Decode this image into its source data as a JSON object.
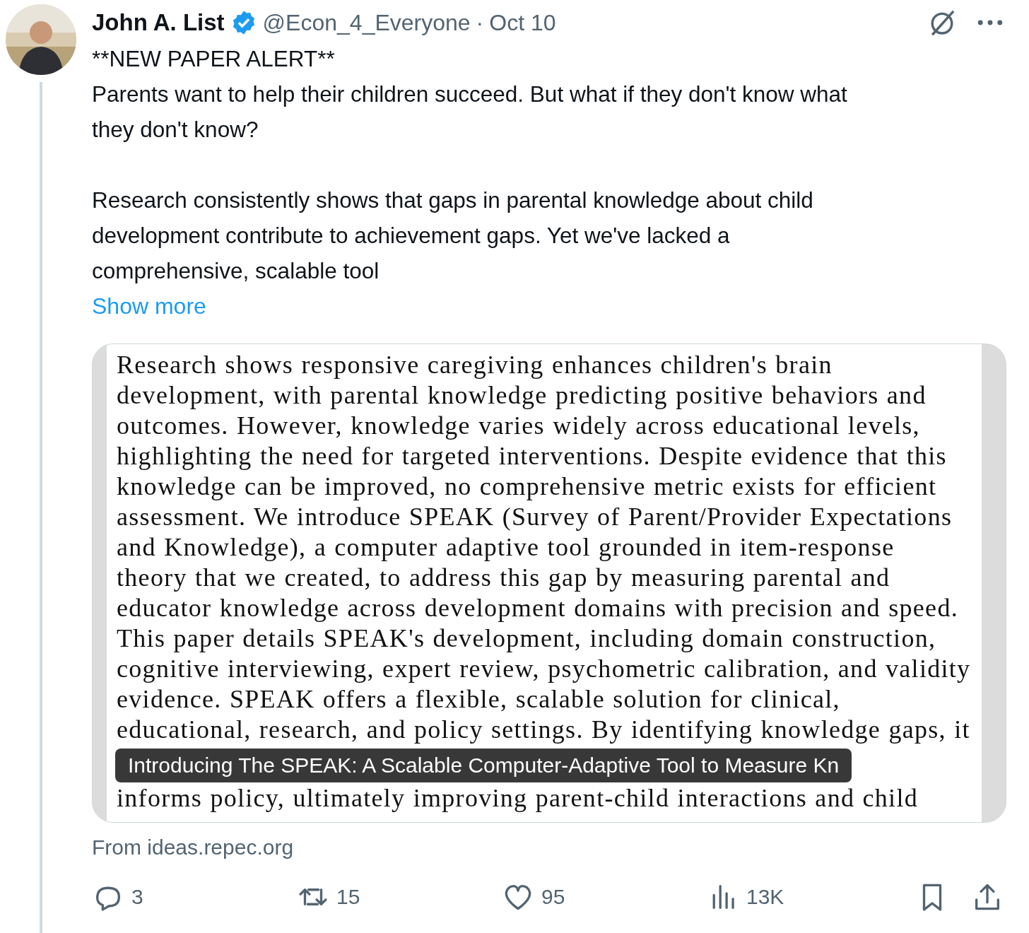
{
  "author": {
    "name": "John A. List",
    "verified": true,
    "handle": "@Econ_4_Everyone",
    "separator": "·",
    "date": "Oct 10"
  },
  "body": [
    "**NEW PAPER ALERT**\nParents want to help their children succeed. But what if they don't know what\nthey don't know?",
    "Research consistently shows that gaps in parental knowledge about child\ndevelopment contribute to achievement gaps. Yet we've lacked a\ncomprehensive, scalable tool"
  ],
  "show_more": "Show more",
  "card": {
    "document_lines": [
      "Research shows responsive caregiving enhances children's brain",
      "development, with parental knowledge predicting positive behaviors and",
      "outcomes. However, knowledge varies widely across educational levels,",
      "highlighting the need for targeted interventions. Despite evidence that this",
      "knowledge can be improved, no comprehensive metric exists for efficient",
      "assessment. We introduce SPEAK (Survey of Parent/Provider Expectations",
      "and Knowledge), a computer adaptive tool grounded in item-response",
      "theory that we created, to address this gap by measuring parental and",
      "educator knowledge across development domains with precision and speed.",
      "This paper details SPEAK's development, including domain construction,",
      "cognitive interviewing, expert review, psychometric calibration, and validity",
      "evidence. SPEAK offers a flexible, scalable solution for clinical,",
      "educational, research, and policy settings. By identifying knowledge gaps, it",
      "informs policy, ultimately improving parent-child interactions and child"
    ],
    "caption": "Introducing The SPEAK: A Scalable Computer-Adaptive Tool to Measure Kn"
  },
  "source": "From ideas.repec.org",
  "actions": [
    {
      "kind": "reply",
      "count": "3"
    },
    {
      "kind": "repost",
      "count": "15"
    },
    {
      "kind": "like",
      "count": "95"
    },
    {
      "kind": "views",
      "count": "13K"
    },
    {
      "kind": "bookmark"
    },
    {
      "kind": "share"
    }
  ]
}
